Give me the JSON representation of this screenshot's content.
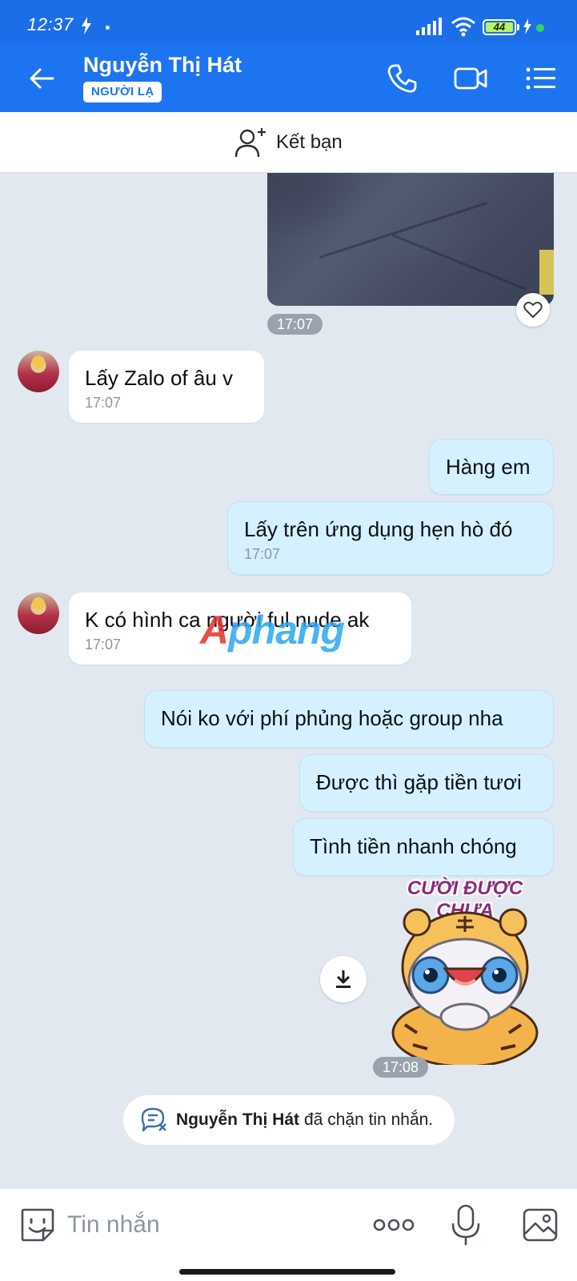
{
  "status_bar": {
    "time": "12:37",
    "battery": "44"
  },
  "header": {
    "contact_name": "Nguyễn Thị Hát",
    "badge": "NGƯỜI LẠ"
  },
  "add_friend": {
    "label": "Kết bạn"
  },
  "messages": [
    {
      "direction": "out",
      "kind": "photo",
      "time": "17:07"
    },
    {
      "direction": "in",
      "text": "Lấy Zalo of âu v",
      "time": "17:07"
    },
    {
      "direction": "out",
      "text": "Hàng em"
    },
    {
      "direction": "out",
      "text": "Lấy trên ứng dụng hẹn hò đó",
      "time": "17:07"
    },
    {
      "direction": "in",
      "text": "K có hình ca người ful nude ak",
      "time": "17:07"
    },
    {
      "direction": "out",
      "text": "Nói ko với phí phủng hoặc group nha"
    },
    {
      "direction": "out",
      "text": "Được thì gặp tiền tươi"
    },
    {
      "direction": "out",
      "text": "Tình tiền nhanh chóng"
    },
    {
      "direction": "out",
      "kind": "sticker",
      "caption": "CƯỜI ĐƯỢC CHƯA",
      "time": "17:08"
    }
  ],
  "watermark": {
    "part1": "A",
    "part2": "phang"
  },
  "blocked_notice": {
    "name": "Nguyễn Thị Hát",
    "text": "đã chặn tin nhắn."
  },
  "input_bar": {
    "placeholder": "Tin nhắn"
  },
  "colors": {
    "header": "#1d74f0",
    "status_bar": "#1c6ee8",
    "outgoing_bubble": "#d5f0ff",
    "background": "#e2e8ef"
  }
}
